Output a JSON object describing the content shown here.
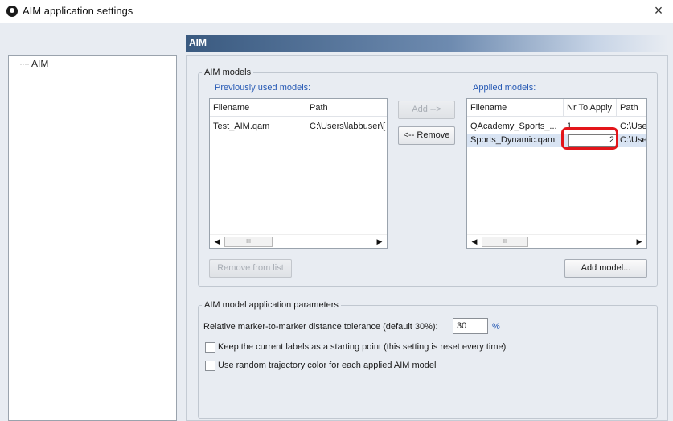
{
  "window": {
    "title": "AIM application settings",
    "close_label": "×"
  },
  "tree": {
    "items": [
      {
        "label": "AIM"
      }
    ]
  },
  "section": {
    "header": "AIM"
  },
  "models_group": {
    "legend": "AIM models",
    "previously_used_label": "Previously used models:",
    "applied_label": "Applied models:",
    "previous_columns": [
      "Filename",
      "Path"
    ],
    "previous_rows": [
      {
        "filename": "Test_AIM.qam",
        "path": "C:\\Users\\labbuser\\["
      }
    ],
    "applied_columns": [
      "Filename",
      "Nr To Apply",
      "Path"
    ],
    "applied_rows": [
      {
        "filename": "QAcademy_Sports_...",
        "nr_to_apply": "1",
        "path": "C:\\Use"
      },
      {
        "filename": "Sports_Dynamic.qam",
        "nr_to_apply": "2",
        "path": "C:\\Use"
      }
    ],
    "add_button": "Add -->",
    "remove_button": "<-- Remove",
    "remove_from_list_button": "Remove from list",
    "add_model_button": "Add model...",
    "scroll_thumb_label": "III"
  },
  "params_group": {
    "legend": "AIM model application parameters",
    "tolerance_label": "Relative marker-to-marker distance tolerance (default 30%):",
    "tolerance_value": "30",
    "tolerance_unit": "%",
    "keep_labels_label": "Keep the current labels as a starting point (this setting is reset every time)",
    "keep_labels_checked": false,
    "random_color_label": "Use random trajectory color for each applied AIM model",
    "random_color_checked": false
  },
  "colors": {
    "accent_blue": "#2659b4",
    "highlight_red": "#e3151a",
    "header_gradient_start": "#3a5a80"
  }
}
